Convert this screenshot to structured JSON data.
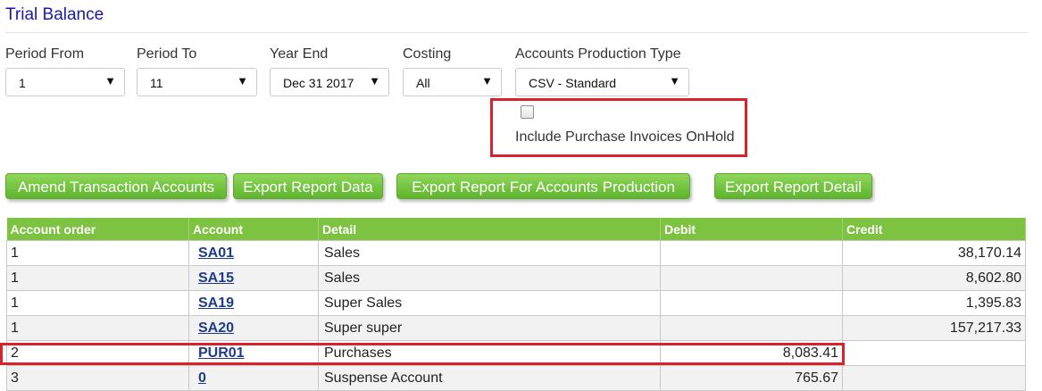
{
  "page": {
    "title": "Trial Balance"
  },
  "filters": {
    "period_from": {
      "label": "Period From",
      "value": "1"
    },
    "period_to": {
      "label": "Period To",
      "value": "11"
    },
    "year_end": {
      "label": "Year End",
      "value": "Dec 31 2017"
    },
    "costing": {
      "label": "Costing",
      "value": "All"
    },
    "accounts_production_type": {
      "label": "Accounts Production Type",
      "value": "CSV - Standard"
    },
    "include_onhold": {
      "label": "Include Purchase Invoices OnHold",
      "checked": false
    },
    "caret": "▼"
  },
  "buttons": {
    "amend": "Amend Transaction Accounts",
    "export_data": "Export Report Data",
    "export_accounts_production": "Export Report For Accounts Production",
    "export_detail": "Export Report Detail"
  },
  "table": {
    "columns": [
      "Account order",
      "Account",
      "Detail",
      "Debit",
      "Credit"
    ],
    "rows": [
      {
        "order": "1",
        "account": "SA01",
        "detail": "Sales",
        "debit": "",
        "credit": "38,170.14"
      },
      {
        "order": "1",
        "account": "SA15",
        "detail": "Sales",
        "debit": "",
        "credit": "8,602.80"
      },
      {
        "order": "1",
        "account": "SA19",
        "detail": "Super Sales",
        "debit": "",
        "credit": "1,395.83"
      },
      {
        "order": "1",
        "account": "SA20",
        "detail": "Super super",
        "debit": "",
        "credit": "157,217.33"
      },
      {
        "order": "2",
        "account": "PUR01",
        "detail": "Purchases",
        "debit": "8,083.41",
        "credit": ""
      },
      {
        "order": "3",
        "account": "0",
        "detail": "Suspense Account",
        "debit": "765.67",
        "credit": ""
      }
    ]
  },
  "colors": {
    "accent_green": "#7ec242",
    "highlight_red": "#d9232c",
    "title_blue": "#1a1aa6"
  }
}
